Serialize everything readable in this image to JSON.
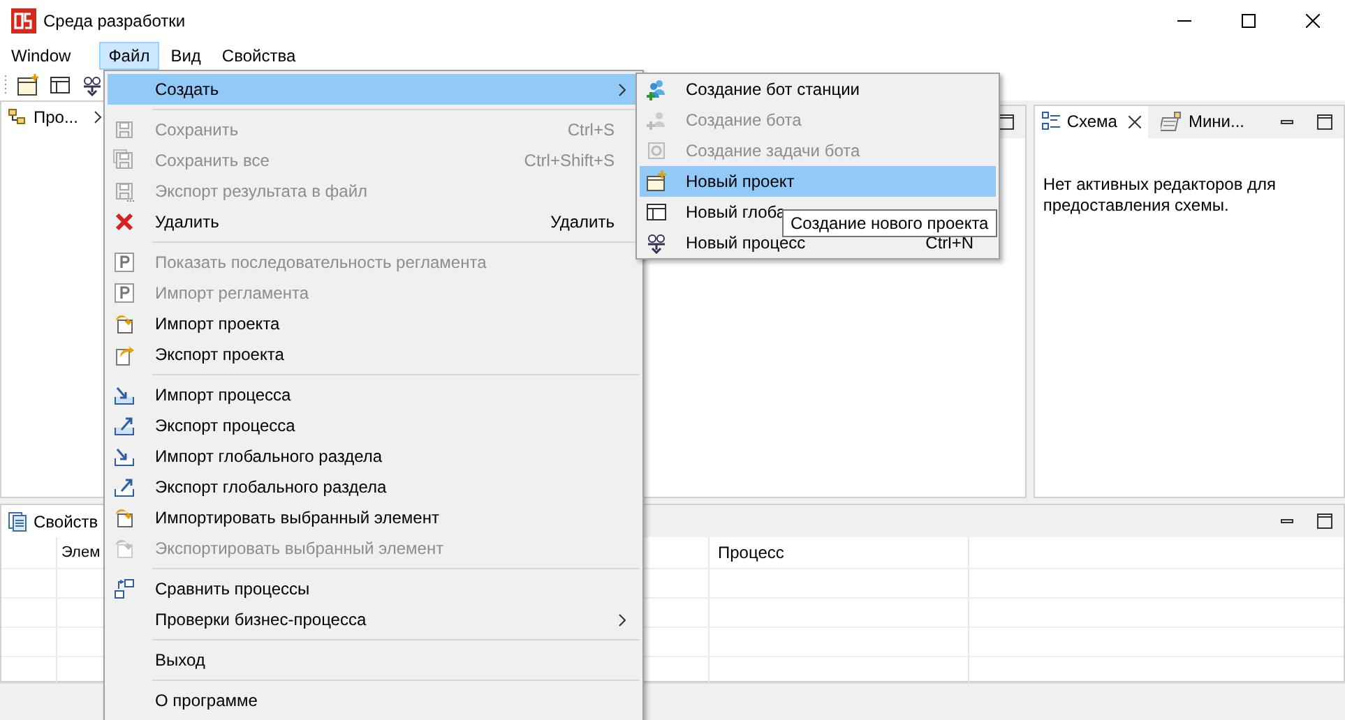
{
  "window": {
    "title": "Среда разработки"
  },
  "menubar": [
    {
      "label": "Window",
      "selected": false
    },
    {
      "label": "Файл",
      "selected": true
    },
    {
      "label": "Вид",
      "selected": false
    },
    {
      "label": "Свойства",
      "selected": false
    }
  ],
  "project_panel": {
    "tab_label": "Про..."
  },
  "outline_panel": {
    "tabs": [
      {
        "label": "Схема",
        "selected": true
      },
      {
        "label": "Мини...",
        "selected": false
      }
    ],
    "message": "Нет активных редакторов для предоставления схемы."
  },
  "properties_panel": {
    "tab_label": "Свойств",
    "columns": [
      {
        "label": "Элем"
      },
      {
        "label": "Процесс"
      }
    ]
  },
  "file_menu": {
    "items": [
      {
        "kind": "item",
        "label": "Создать",
        "selected": true,
        "disabled": false,
        "submenu": true
      },
      {
        "kind": "separator"
      },
      {
        "kind": "item",
        "label": "Сохранить",
        "shortcut": "Ctrl+S",
        "selected": false,
        "disabled": true,
        "submenu": false
      },
      {
        "kind": "item",
        "label": "Сохранить все",
        "shortcut": "Ctrl+Shift+S",
        "selected": false,
        "disabled": true,
        "submenu": false
      },
      {
        "kind": "item",
        "label": "Экспорт результата в файл",
        "selected": false,
        "disabled": true,
        "submenu": false
      },
      {
        "kind": "item",
        "label": "Удалить",
        "shortcut": "Удалить",
        "selected": false,
        "disabled": false,
        "submenu": false
      },
      {
        "kind": "separator"
      },
      {
        "kind": "item",
        "label": "Показать последовательность регламента",
        "selected": false,
        "disabled": true,
        "submenu": false
      },
      {
        "kind": "item",
        "label": "Импорт регламента",
        "selected": false,
        "disabled": true,
        "submenu": false
      },
      {
        "kind": "item",
        "label": "Импорт проекта",
        "selected": false,
        "disabled": false,
        "submenu": false
      },
      {
        "kind": "item",
        "label": "Экспорт проекта",
        "selected": false,
        "disabled": false,
        "submenu": false
      },
      {
        "kind": "separator"
      },
      {
        "kind": "item",
        "label": "Импорт процесса",
        "selected": false,
        "disabled": false,
        "submenu": false
      },
      {
        "kind": "item",
        "label": "Экспорт процесса",
        "selected": false,
        "disabled": false,
        "submenu": false
      },
      {
        "kind": "item",
        "label": "Импорт глобального раздела",
        "selected": false,
        "disabled": false,
        "submenu": false
      },
      {
        "kind": "item",
        "label": "Экспорт глобального раздела",
        "selected": false,
        "disabled": false,
        "submenu": false
      },
      {
        "kind": "item",
        "label": "Импортировать выбранный элемент",
        "selected": false,
        "disabled": false,
        "submenu": false
      },
      {
        "kind": "item",
        "label": "Экспортировать выбранный элемент",
        "selected": false,
        "disabled": true,
        "submenu": false
      },
      {
        "kind": "separator"
      },
      {
        "kind": "item",
        "label": "Сравнить процессы",
        "selected": false,
        "disabled": false,
        "submenu": false
      },
      {
        "kind": "item",
        "label": "Проверки бизнес-процесса",
        "selected": false,
        "disabled": false,
        "submenu": true
      },
      {
        "kind": "separator"
      },
      {
        "kind": "item",
        "label": "Выход",
        "selected": false,
        "disabled": false,
        "submenu": false
      },
      {
        "kind": "separator"
      },
      {
        "kind": "item",
        "label": "О программе",
        "selected": false,
        "disabled": false,
        "submenu": false
      }
    ]
  },
  "create_submenu": {
    "items": [
      {
        "label": "Создание бот станции",
        "selected": false,
        "disabled": false
      },
      {
        "label": "Создание бота",
        "selected": false,
        "disabled": true
      },
      {
        "label": "Создание задачи бота",
        "selected": false,
        "disabled": true
      },
      {
        "label": "Новый проект",
        "selected": true,
        "disabled": false
      },
      {
        "label": "Новый глоба",
        "selected": false,
        "disabled": false
      },
      {
        "label": "Новый процесс",
        "shortcut": "Ctrl+N",
        "selected": false,
        "disabled": false
      }
    ],
    "tooltip": "Создание нового проекта"
  }
}
